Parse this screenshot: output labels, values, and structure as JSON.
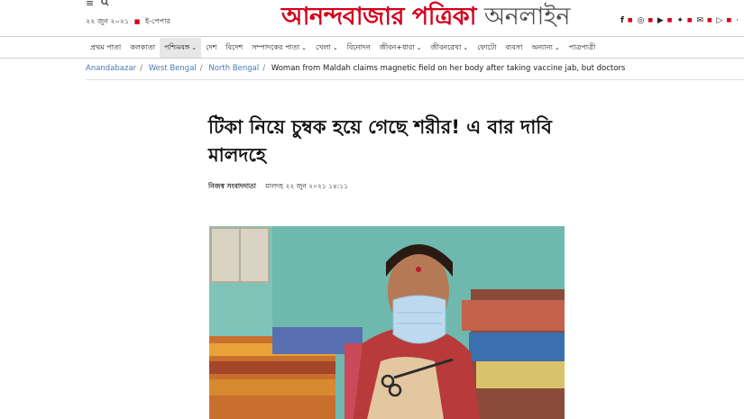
{
  "header": {
    "menu_icon": "hamburger-icon",
    "search_icon": "search-icon",
    "date": "২২ জুন ২০২১",
    "epaper_label": "ই-পেপার",
    "logo_red": "আনন্দবাজার পত্রিকা",
    "logo_gray": "অনলাইন",
    "social_icons": [
      "facebook-icon",
      "instagram-icon",
      "youtube-icon",
      "twitter-icon",
      "mail-icon",
      "play-store-icon",
      "more-icon"
    ]
  },
  "nav": {
    "items": [
      {
        "label": "প্রথম পাতা"
      },
      {
        "label": "কলকাতা"
      },
      {
        "label": "পশ্চিমবঙ্গ",
        "active": true,
        "dropdown": true
      },
      {
        "label": "দেশ"
      },
      {
        "label": "বিদেশ"
      },
      {
        "label": "সম্পাদকের পাতা",
        "dropdown": true
      },
      {
        "label": "খেলা",
        "dropdown": true
      },
      {
        "label": "বিনোদন"
      },
      {
        "label": "জীবন+ধারা",
        "dropdown": true
      },
      {
        "label": "জীবনরেখা",
        "dropdown": true
      },
      {
        "label": "ফোটো"
      },
      {
        "label": "ব্যবসা"
      },
      {
        "label": "অন্যান্য",
        "dropdown": true
      },
      {
        "label": "পাত্রপাত্রী"
      }
    ]
  },
  "breadcrumb": {
    "items": [
      "Anandabazar",
      "West Bengal",
      "North Bengal"
    ],
    "current": "Woman from Maldah claims magnetic field on her body after taking vaccine jab, but doctors"
  },
  "article": {
    "headline": "টিকা নিয়ে চুম্বক হয়ে গেছে শরীর! এ বার দাবি মালদহে",
    "author": "নিজস্ব সংবাদদাতা",
    "dateline": "মালদহ ২২ জুন ২০২১ ১৪:১১"
  },
  "colors": {
    "brand_red": "#d4001c",
    "link_blue": "#4a7ab5",
    "nav_active_bg": "#e7e7e7"
  }
}
